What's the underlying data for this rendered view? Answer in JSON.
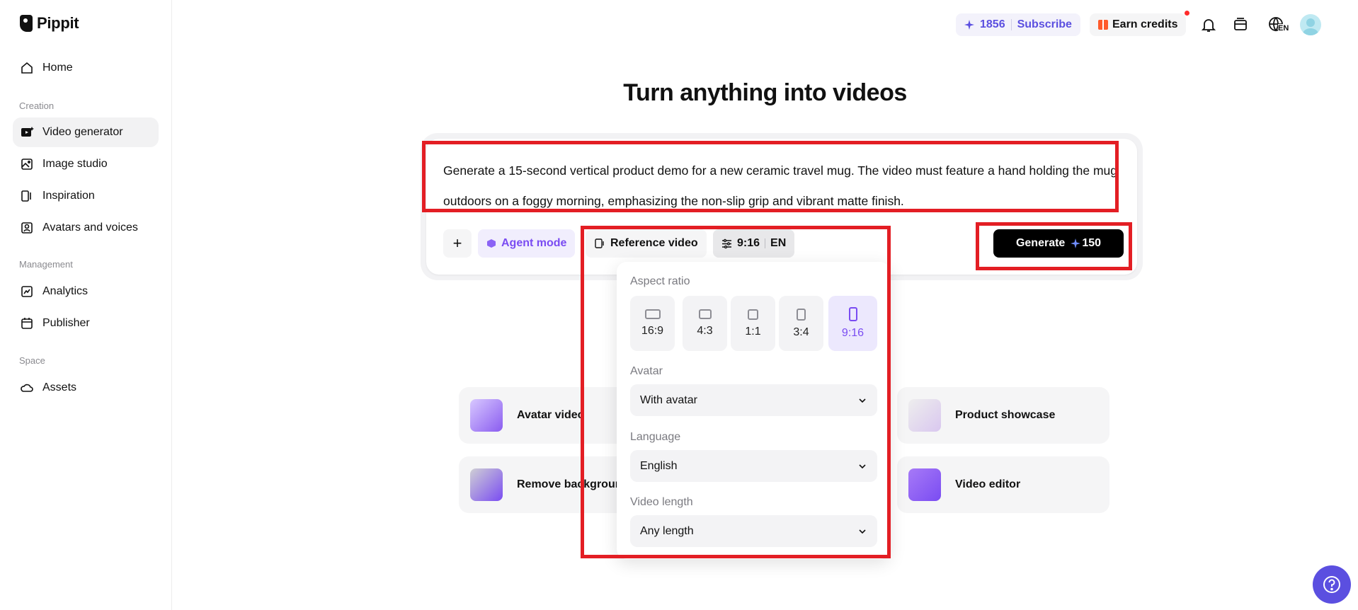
{
  "app": {
    "name": "Pippit"
  },
  "sidebar": {
    "items": [
      {
        "label": "Home",
        "icon": "home-icon"
      },
      {
        "label": "Video generator",
        "icon": "video-generator-icon",
        "active": true
      },
      {
        "label": "Image studio",
        "icon": "image-studio-icon"
      },
      {
        "label": "Inspiration",
        "icon": "inspiration-icon"
      },
      {
        "label": "Avatars and voices",
        "icon": "avatar-icon"
      },
      {
        "label": "Analytics",
        "icon": "analytics-icon"
      },
      {
        "label": "Publisher",
        "icon": "calendar-icon"
      },
      {
        "label": "Assets",
        "icon": "cloud-icon"
      }
    ],
    "sections": {
      "creation": "Creation",
      "management": "Management",
      "space": "Space"
    }
  },
  "topbar": {
    "credits": "1856",
    "subscribe": "Subscribe",
    "earn_credits": "Earn credits",
    "language_badge": "EN"
  },
  "main": {
    "title": "Turn anything into videos",
    "prompt": "Generate a 15-second vertical product demo for a new ceramic travel mug. The video must feature a hand holding the mug outdoors on a foggy morning, emphasizing the non-slip grip and vibrant matte finish.",
    "toolbar": {
      "plus": "+",
      "agent_mode": "Agent mode",
      "reference_video": "Reference video",
      "ratio": "9:16",
      "lang": "EN",
      "generate": "Generate",
      "generate_cost": "150"
    },
    "cards": [
      {
        "label": "Avatar video"
      },
      {
        "label": "Remove background"
      },
      {
        "label": "Product showcase"
      },
      {
        "label": "Video editor"
      }
    ]
  },
  "popover": {
    "aspect_ratio_label": "Aspect ratio",
    "ratios": [
      "16:9",
      "4:3",
      "1:1",
      "3:4",
      "9:16"
    ],
    "selected_ratio": "9:16",
    "avatar_label": "Avatar",
    "avatar_value": "With avatar",
    "language_label": "Language",
    "language_value": "English",
    "length_label": "Video length",
    "length_value": "Any length"
  },
  "colors": {
    "accent": "#7a4cf2",
    "brand": "#5b4fe0",
    "annotation": "#e31e24"
  }
}
